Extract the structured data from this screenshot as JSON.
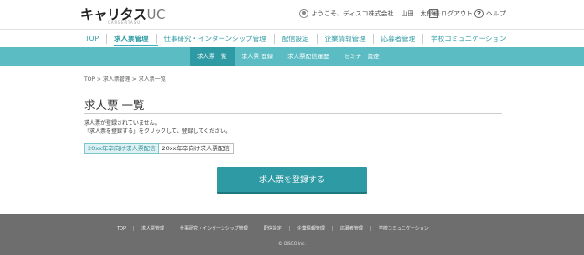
{
  "header": {
    "logo_main": "キャリタス",
    "logo_uc": "UC",
    "logo_sub": "CAREERTASU",
    "greeting": "ようこそ、ディスコ株式会社",
    "user_name": "山田　太郎様",
    "logout_label": "ログアウト",
    "help_label": "ヘルプ"
  },
  "main_nav": {
    "items": [
      {
        "label": "TOP"
      },
      {
        "label": "求人票管理"
      },
      {
        "label": "仕事研究・インターンシップ管理"
      },
      {
        "label": "配信設定"
      },
      {
        "label": "企業情報管理"
      },
      {
        "label": "応募者管理"
      },
      {
        "label": "学校コミュニケーション"
      }
    ],
    "active_index": 1
  },
  "sub_nav": {
    "items": [
      {
        "label": "求人票一覧"
      },
      {
        "label": "求人票 登録"
      },
      {
        "label": "求人票配信履歴"
      },
      {
        "label": "セミナー設定"
      }
    ],
    "active_index": 0
  },
  "breadcrumb": "TOP > 求人票管理 > 求人票一覧",
  "page": {
    "title": "求人票 一覧",
    "message_line1": "求人票が登録されていません。",
    "message_line2": "「求人票を登録する」をクリックして、登録してください。",
    "tabs": [
      {
        "label": "20xx年卒向け求人票配信"
      },
      {
        "label": "20xx年卒向け求人票配信"
      }
    ],
    "active_tab": 0,
    "register_button": "求人票を登録する"
  },
  "footer": {
    "links": [
      {
        "label": "TOP"
      },
      {
        "label": "求人票管理"
      },
      {
        "label": "仕事研究・インターンシップ管理"
      },
      {
        "label": "配信設定"
      },
      {
        "label": "企業情報管理"
      },
      {
        "label": "応募者管理"
      },
      {
        "label": "学校コミュニケーション"
      }
    ],
    "copyright": "© DISCO Inc."
  },
  "colors": {
    "accent": "#2e9aa4",
    "subnav_bg": "#5bbcc4",
    "footer_bg": "#6e6e6e"
  }
}
